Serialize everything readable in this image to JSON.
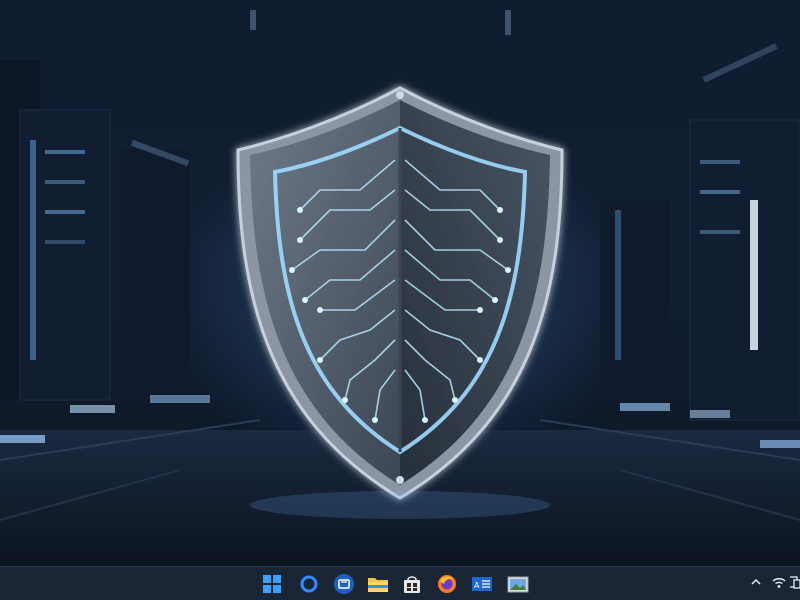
{
  "desktop": {
    "wallpaper": "cybersecurity-shield-wallpaper",
    "accent_color": "#8fd0ff"
  },
  "taskbar": {
    "background": "#1a2536",
    "pinned": [
      {
        "name": "start-button",
        "icon": "windows-logo-icon"
      },
      {
        "name": "cortana-button",
        "icon": "cortana-ring-icon"
      },
      {
        "name": "task-view-button",
        "icon": "task-view-icon"
      },
      {
        "name": "file-explorer-button",
        "icon": "folder-icon"
      },
      {
        "name": "store-button",
        "icon": "store-bag-icon"
      },
      {
        "name": "firefox-button",
        "icon": "firefox-icon"
      },
      {
        "name": "mail-button",
        "icon": "mail-icon"
      },
      {
        "name": "photos-button",
        "icon": "photos-icon"
      }
    ],
    "tray": [
      {
        "name": "show-hidden-icons-button",
        "icon": "chevron-up-icon"
      },
      {
        "name": "network-button",
        "icon": "wifi-icon"
      },
      {
        "name": "notifications-button",
        "icon": "devices-icon"
      }
    ]
  }
}
